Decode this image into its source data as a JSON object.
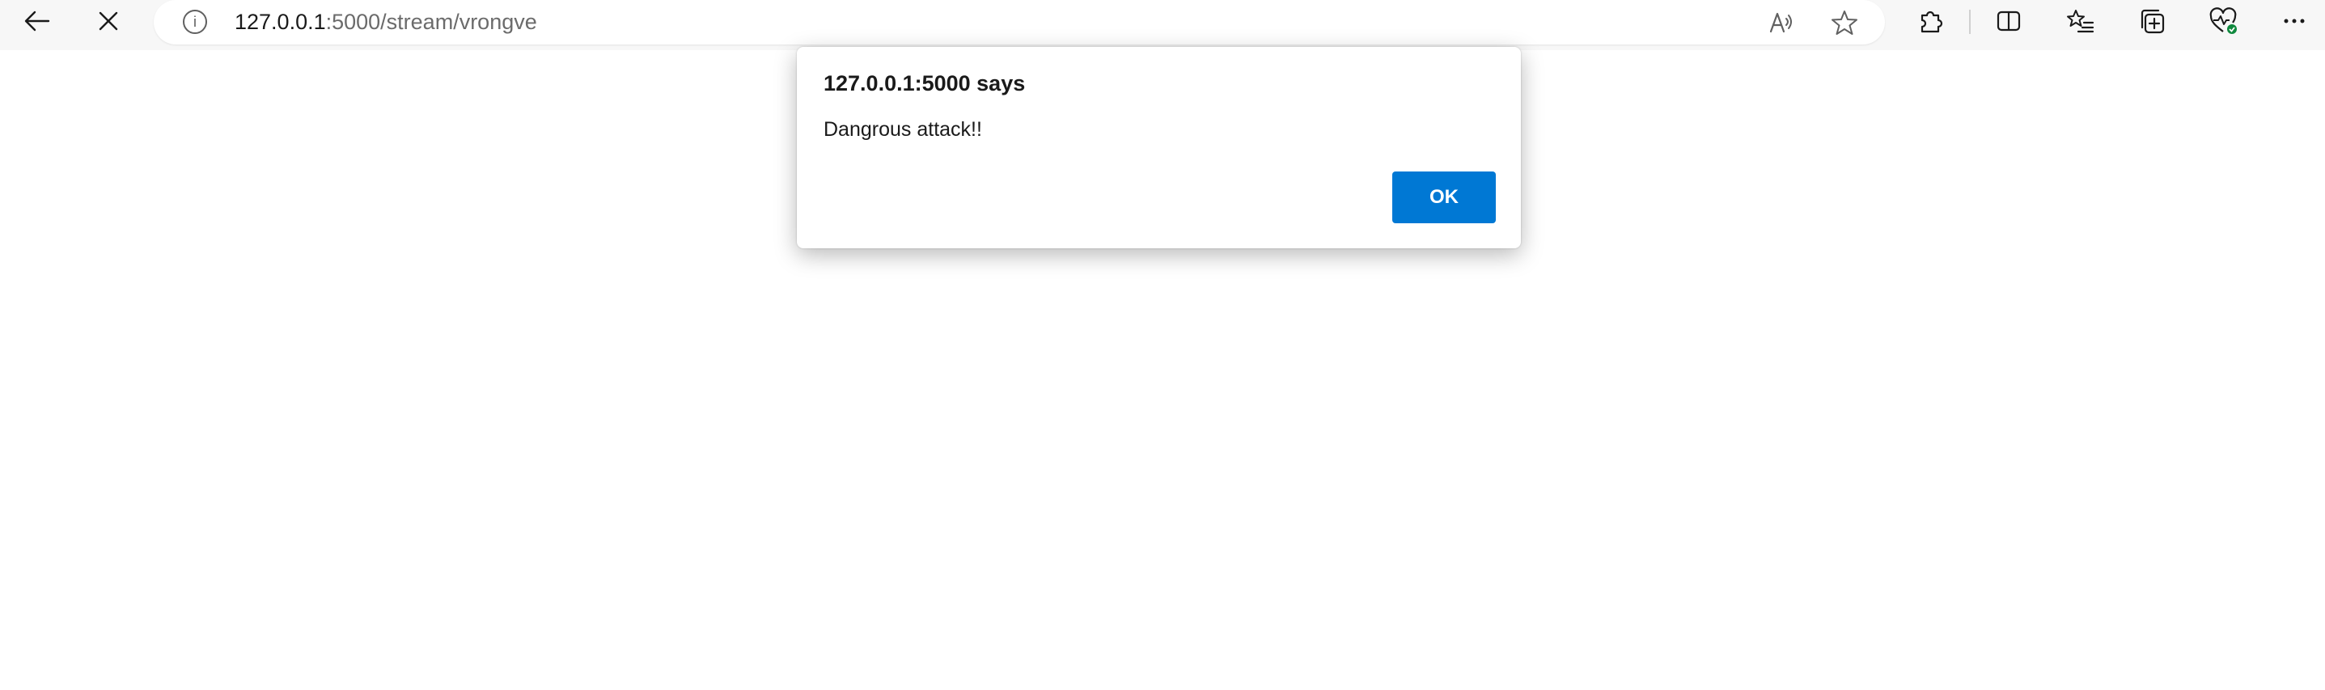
{
  "browser": {
    "url_host": "127.0.0.1",
    "url_path": ":5000/stream/vrongve",
    "icons": {
      "back": "back-arrow-icon",
      "stop": "close-icon",
      "site_info": "info-icon",
      "read_aloud": "read-aloud-icon",
      "favorite": "star-icon",
      "extensions": "puzzle-icon",
      "split_screen": "split-screen-icon",
      "favorites": "favorites-list-icon",
      "collections": "collections-icon",
      "performance": "heart-pulse-icon",
      "more": "more-icon"
    },
    "info_glyph": "i"
  },
  "dialog": {
    "title": "127.0.0.1:5000 says",
    "message": "Dangrous attack!!",
    "ok_label": "OK",
    "ok_color": "#0078d4"
  }
}
